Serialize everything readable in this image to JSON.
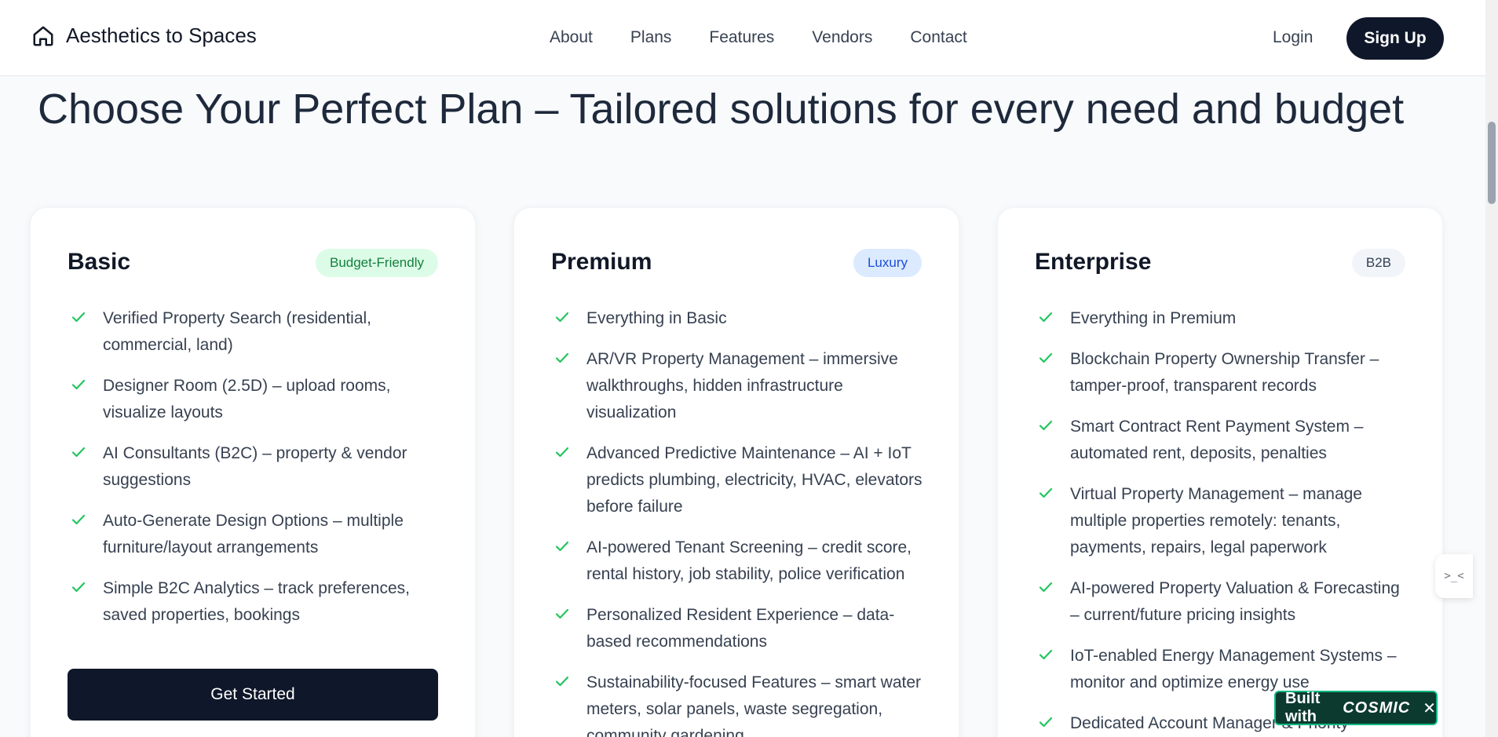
{
  "header": {
    "brand": "Aesthetics to Spaces",
    "nav": [
      "About",
      "Plans",
      "Features",
      "Vendors",
      "Contact"
    ],
    "login": "Login",
    "signup": "Sign Up"
  },
  "page_title": "Choose Your Perfect Plan – Tailored solutions for every need and budget",
  "plans": [
    {
      "name": "Basic",
      "badge": "Budget-Friendly",
      "badge_bg": "#dcfce7",
      "badge_color": "#15803d",
      "features": [
        "Verified Property Search (residential, commercial, land)",
        "Designer Room (2.5D) – upload rooms, visualize layouts",
        "AI Consultants (B2C) – property & vendor suggestions",
        "Auto-Generate Design Options – multiple furniture/layout arrangements",
        "Simple B2C Analytics – track preferences, saved properties, bookings"
      ],
      "cta": "Get Started"
    },
    {
      "name": "Premium",
      "badge": "Luxury",
      "badge_bg": "#dbeafe",
      "badge_color": "#1d4ed8",
      "features": [
        "Everything in Basic",
        "AR/VR Property Management – immersive walkthroughs, hidden infrastructure visualization",
        "Advanced Predictive Maintenance – AI + IoT predicts plumbing, electricity, HVAC, elevators before failure",
        "AI-powered Tenant Screening – credit score, rental history, job stability, police verification",
        "Personalized Resident Experience – data-based recommendations",
        "Sustainability-focused Features – smart water meters, solar panels, waste segregation, community gardening"
      ]
    },
    {
      "name": "Enterprise",
      "badge": "B2B",
      "badge_bg": "#f1f5f9",
      "badge_color": "#334155",
      "features": [
        "Everything in Premium",
        "Blockchain Property Ownership Transfer – tamper-proof, transparent records",
        "Smart Contract Rent Payment System – automated rent, deposits, penalties",
        "Virtual Property Management – manage multiple properties remotely: tenants, payments, repairs, legal paperwork",
        "AI-powered Property Valuation & Forecasting – current/future pricing insights",
        "IoT-enabled Energy Management Systems – monitor and optimize energy use",
        "Dedicated Account Manager & Priority"
      ]
    }
  ],
  "widget": {
    "side_icon": ">_<",
    "built_with": "Built with",
    "brand": "COSMIC",
    "close": "✕"
  },
  "colors": {
    "accent_dark": "#0f172a",
    "check_green": "#22c55e"
  }
}
